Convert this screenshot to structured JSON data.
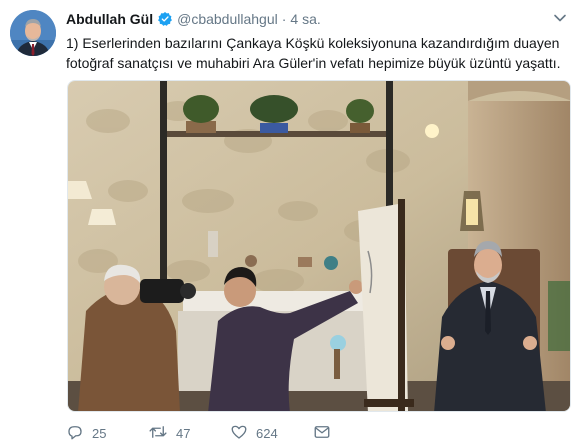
{
  "tweet": {
    "author_name": "Abdullah Gül",
    "handle": "@cbabdullahgul",
    "separator": "·",
    "time": "4 sa.",
    "text_lines": [
      "1) Eserlerinden bazılarını Çankaya Köşkü koleksiyonuna kazandırdığım duayen",
      "fotoğraf sanatçısı ve muhabiri Ara Güler'in vefatı hepimize büyük üzüntü yaşattı."
    ],
    "verified": true
  },
  "actions": {
    "replies": "25",
    "retweets": "47",
    "likes": "624"
  },
  "icons": {
    "verified": "verified-badge-icon",
    "chevron": "chevron-down-icon",
    "reply": "reply-icon",
    "retweet": "retweet-icon",
    "like": "heart-icon",
    "dm": "envelope-icon"
  },
  "colors": {
    "text": "#14171a",
    "secondary": "#657786",
    "verified": "#1da1f2"
  }
}
